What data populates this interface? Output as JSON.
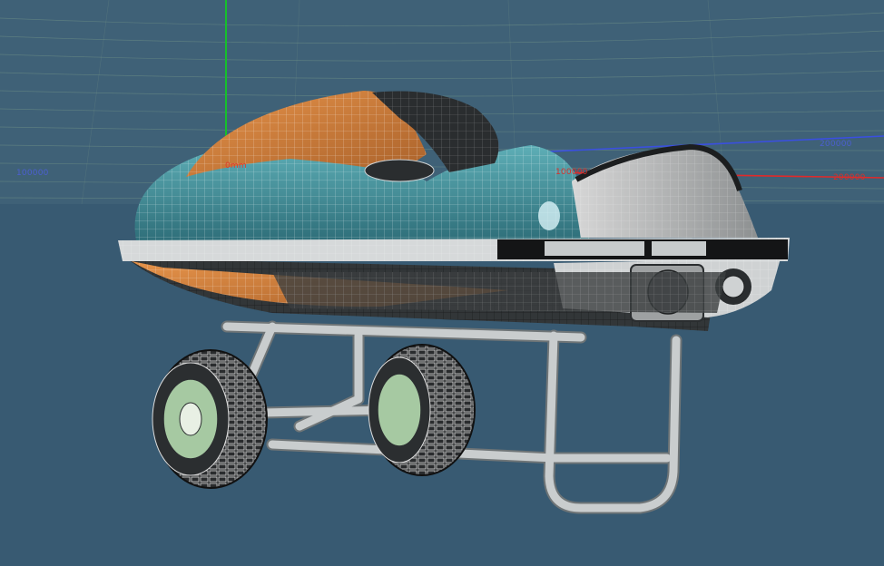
{
  "viewport": {
    "background": "#385a72",
    "horizon_color": "#3f6177",
    "grid_line_color": "#7fa08c",
    "axis_colors": {
      "x": "#e02a2a",
      "y": "#16c02a",
      "z": "#3a4fe0"
    }
  },
  "coordinate_labels": {
    "left_blue": "100000",
    "origin_red": "0mm",
    "right_blue": "200000",
    "right_red": "200000",
    "mid_red": "100000"
  },
  "model": {
    "object": "jet-ski-on-trailer",
    "display_mode": "wireframe-shaded",
    "hull_color": "#3f8d96",
    "seat_color": "#d1813c",
    "metal_color": "#b8bcbd",
    "tire_color": "#2b2e30",
    "rim_color": "#a6c9a2"
  }
}
